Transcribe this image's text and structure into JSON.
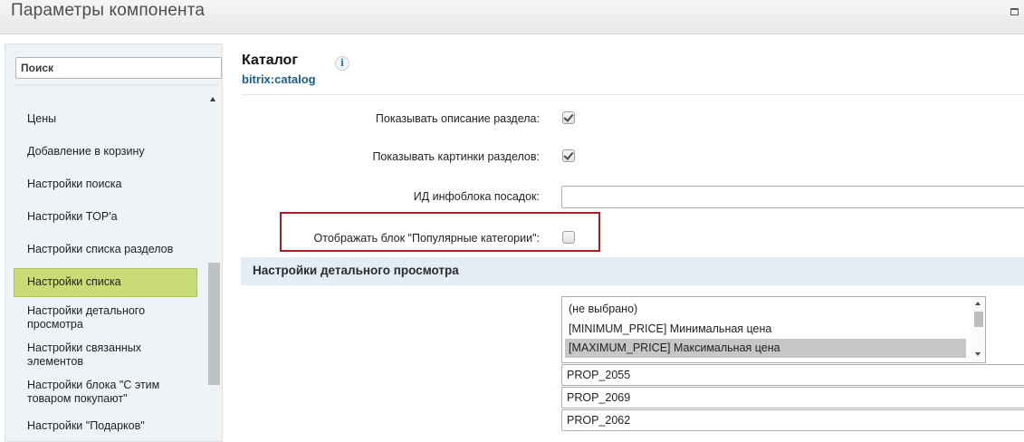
{
  "window": {
    "title": "Параметры компонента",
    "maximize_icon": "maximize-icon"
  },
  "sidebar": {
    "search_placeholder": "Поиск",
    "items": [
      {
        "label": "Цены"
      },
      {
        "label": "Добавление в корзину"
      },
      {
        "label": "Настройки поиска"
      },
      {
        "label": "Настройки TOP'а"
      },
      {
        "label": "Настройки списка разделов"
      },
      {
        "label": "Настройки списка",
        "active": true
      },
      {
        "label": "Настройки детального просмотра"
      },
      {
        "label": "Настройки связанных элементов"
      },
      {
        "label": "Настройки блока \"С этим товаром покупают\""
      },
      {
        "label": "Настройки \"Подарков\""
      }
    ]
  },
  "component": {
    "name": "Каталог",
    "code": "bitrix:catalog",
    "info_icon": "info-icon"
  },
  "settings": [
    {
      "label": "Показывать описание раздела:",
      "checked": true
    },
    {
      "label": "Показывать картинки разделов:",
      "checked": true
    },
    {
      "label": "ИД инфоблока посадок:",
      "value": ""
    },
    {
      "label": "Отображать блок \"Популярные категории\":",
      "checked": false
    }
  ],
  "section": {
    "title": "Настройки детального просмотра"
  },
  "listbox": {
    "options": [
      {
        "label": "(не выбрано)",
        "selected": false
      },
      {
        "label": "[MINIMUM_PRICE] Минимальная цена",
        "selected": false
      },
      {
        "label": "[MAXIMUM_PRICE] Максимальная цена",
        "selected": true
      }
    ]
  },
  "props": [
    "PROP_2055",
    "PROP_2069",
    "PROP_2062"
  ],
  "colors": {
    "accent_active": "#c9db75",
    "section_bg": "#e3edf5",
    "link": "#1c5d86",
    "highlight_border": "#a51f24"
  }
}
